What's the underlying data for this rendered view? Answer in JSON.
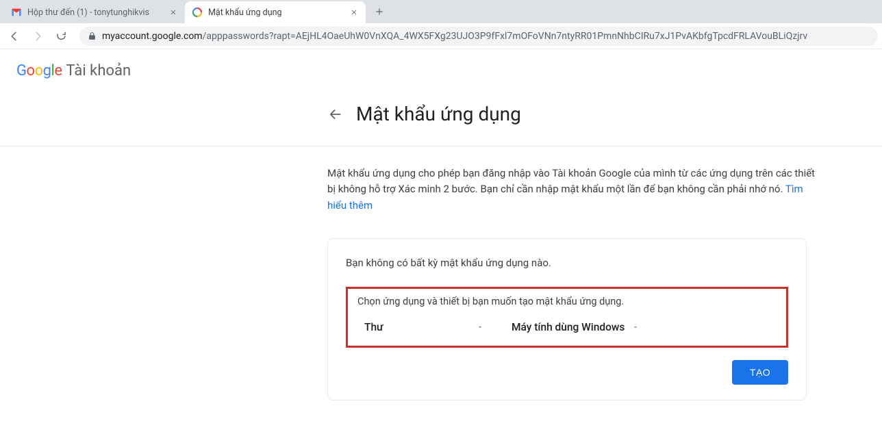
{
  "browser": {
    "tabs": [
      {
        "title": "Hộp thư đến (1) - tonytunghikvis",
        "active": false,
        "favicon": "gmail"
      },
      {
        "title": "Mật khẩu ứng dụng",
        "active": true,
        "favicon": "google"
      }
    ],
    "url_host": "myaccount.google.com",
    "url_path": "/apppasswords?rapt=AEjHL4OaeUhW0VnXQA_4WX5FXg23UJO3P9fFxl7mOFoVNn7ntyRR01PmnNhbCIRu7xJ1PvAKbfgTpcdFRLAVouBLiQzjrv"
  },
  "header": {
    "logo_parts": [
      "G",
      "o",
      "o",
      "g",
      "l",
      "e"
    ],
    "product": "Tài khoản"
  },
  "page": {
    "title": "Mật khẩu ứng dụng",
    "description_before_link": "Mật khẩu ứng dụng cho phép bạn đăng nhập vào Tài khoản Google của mình từ các ứng dụng trên các thiết bị không hỗ trợ Xác minh 2 bước. Bạn chỉ cần nhập mật khẩu một lần để bạn không cần phải nhớ nó. ",
    "learn_more": "Tìm hiểu thêm"
  },
  "card": {
    "no_passwords": "Bạn không có bất kỳ mật khẩu ứng dụng nào.",
    "instruction": "Chọn ứng dụng và thiết bị bạn muốn tạo mật khẩu ứng dụng.",
    "app_select": "Thư",
    "device_select": "Máy tính dùng Windows",
    "create_button": "TẠO"
  }
}
